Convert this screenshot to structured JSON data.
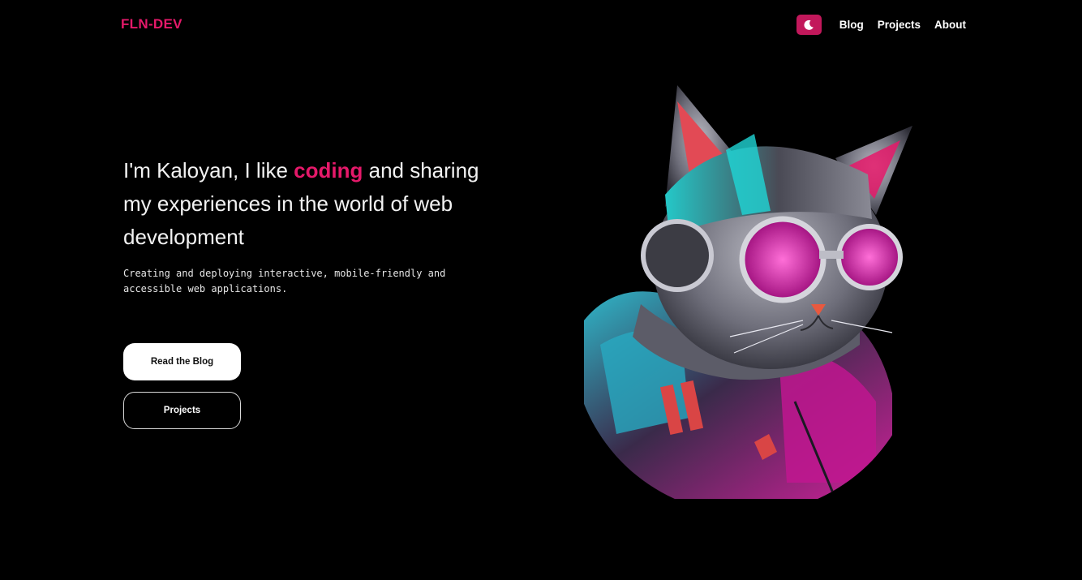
{
  "header": {
    "logo": "FLN-DEV",
    "theme_toggle_icon": "moon-icon",
    "nav": [
      {
        "label": "Blog"
      },
      {
        "label": "Projects"
      },
      {
        "label": "About"
      }
    ]
  },
  "hero": {
    "title_part1": "I'm Kaloyan, I like ",
    "title_accent": "coding",
    "title_part2": " and sharing my experiences in the world of web development",
    "subtitle": "Creating and deploying interactive, mobile-friendly and accessible web applications.",
    "primary_button": "Read the Blog",
    "secondary_button": "Projects",
    "image_icon": "cyberpunk-cat-illustration"
  },
  "colors": {
    "background": "#000000",
    "accent": "#e5196a",
    "toggle_bg": "#c2185b",
    "text": "#ffffff"
  }
}
